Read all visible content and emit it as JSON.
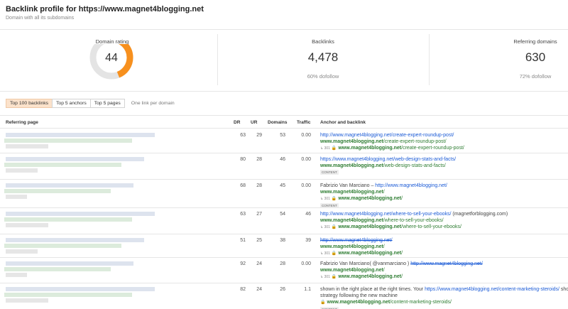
{
  "header": {
    "title": "Backlink profile for https://www.magnet4blogging.net",
    "subtitle": "Domain with all its subdomains"
  },
  "metrics": {
    "domain_rating": {
      "label": "Domain rating",
      "value": "44",
      "fraction": 0.44
    },
    "backlinks": {
      "label": "Backlinks",
      "value": "4,478",
      "sub": "60% dofollow"
    },
    "referring_domains": {
      "label": "Referring domains",
      "value": "630",
      "sub": "72% dofollow"
    }
  },
  "tabs": [
    "Top 100 backlinks",
    "Top 5 anchors",
    "Top 5 pages"
  ],
  "tab_note": "One link per domain",
  "columns": {
    "referring_page": "Referring page",
    "dr": "DR",
    "ur": "UR",
    "domains": "Domains",
    "traffic": "Traffic",
    "anchor": "Anchor and backlink"
  },
  "rows": [
    {
      "dr": "63",
      "ur": "29",
      "domains": "53",
      "traffic": "0.00",
      "l1": "http://www.magnet4blogging.net/create-expert-roundup-post/",
      "l2b": "www.magnet4blogging.net",
      "l2p": "/create-expert-roundup-post/",
      "redir": "301",
      "l3b": "www.magnet4blogging.net",
      "l3p": "/create-expert-roundup-post/"
    },
    {
      "dr": "80",
      "ur": "28",
      "domains": "46",
      "traffic": "0.00",
      "l1": "https://www.magnet4blogging.net/web-design-stats-and-facts/",
      "l2b": "www.magnet4blogging.net",
      "l2p": "/web-design-stats-and-facts/",
      "tag": "CONTENT"
    },
    {
      "dr": "68",
      "ur": "28",
      "domains": "45",
      "traffic": "0.00",
      "l1a": "Fabrizio Van Marciano – ",
      "l1b": "http://www.magnet4blogging.net/",
      "l2b": "www.magnet4blogging.net",
      "l2p": "/",
      "redir": "301",
      "l3b": "www.magnet4blogging.net",
      "l3p": "/",
      "tag": "CONTENT"
    },
    {
      "dr": "63",
      "ur": "27",
      "domains": "54",
      "traffic": "46",
      "l1": "http://www.magnet4blogging.net/where-to-sell-your-ebooks/",
      "l1c": " (magnetforblogging.com)",
      "l2b": "www.magnet4blogging.net",
      "l2p": "/where-to-sell-your-ebooks/",
      "redir": "301",
      "l3b": "www.magnet4blogging.net",
      "l3p": "/where-to-sell-your-ebooks/"
    },
    {
      "dr": "51",
      "ur": "25",
      "domains": "38",
      "traffic": "39",
      "l1": "http://www.magnet4blogging.net/",
      "l2b": "www.magnet4blogging.net",
      "l2p": "/",
      "redir": "301",
      "l3b": "www.magnet4blogging.net",
      "l3p": "/"
    },
    {
      "dr": "92",
      "ur": "24",
      "domains": "28",
      "traffic": "0.00",
      "l1a": "Fabrizio Van Marciano( @vanmarciano ) ",
      "l1b": "http://www.magnet4blogging.net/",
      "l2b": "www.magnet4blogging.net",
      "l2p": "/",
      "redir": "301",
      "l3b": "www.magnet4blogging.net",
      "l3p": "/"
    },
    {
      "dr": "82",
      "ur": "24",
      "domains": "26",
      "traffic": "1.1",
      "l1a": "shown in the right place at the right times. Your ",
      "l1b": "https://www.magnet4blogging.net/content-marketing-steroids/",
      "l1c": " sho",
      "l1d": "strategy following the new machine",
      "l3b": "www.magnet4blogging.net",
      "l3p": "/content-marketing-steroids/",
      "tag": "CONTENT"
    }
  ],
  "colors": {
    "accent": "#f7901e",
    "ring_bg": "#e4e4e4",
    "link": "#1a5ad6",
    "green": "#2e7d32"
  }
}
